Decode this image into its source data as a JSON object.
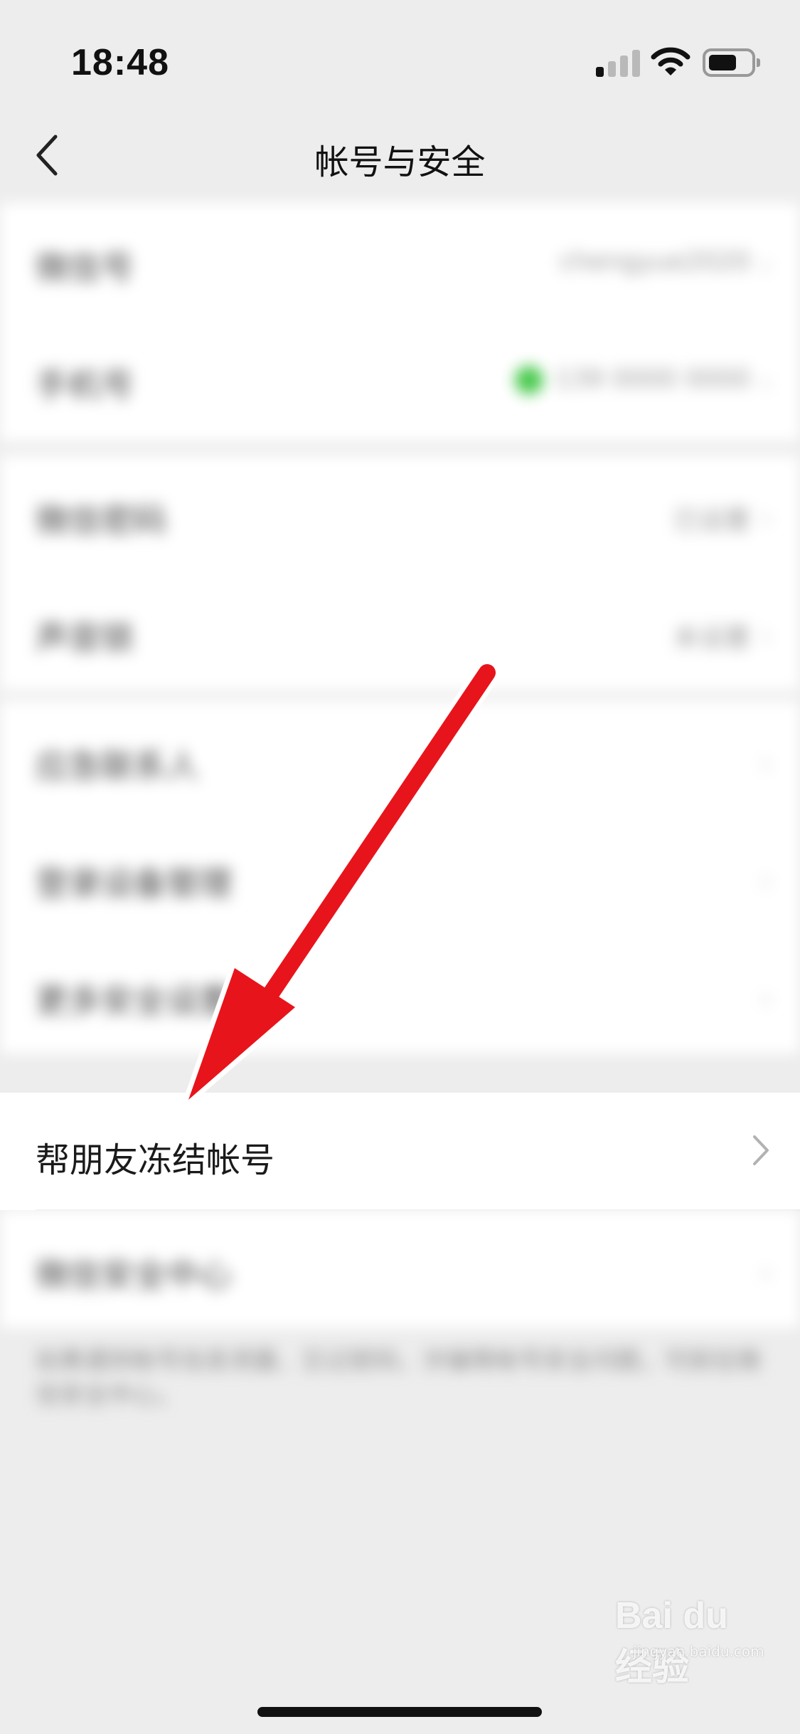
{
  "status_bar": {
    "time": "18:48"
  },
  "nav": {
    "title": "帐号与安全"
  },
  "blurred": {
    "row1_label": "微信号",
    "row1_value": "chengyue2020",
    "row2_label": "手机号",
    "row2_value": "139 0000 0000",
    "row3_label": "微信密码",
    "row3_value": "已设置",
    "row4_label": "声音锁",
    "row4_value": "未设置",
    "row5_label": "应急联系人",
    "row6_label": "登录设备管理",
    "row7_label": "更多安全设置",
    "row9_label": "微信安全中心"
  },
  "friend_freeze": {
    "label": "帮朋友冻结帐号"
  },
  "footnote": "如果遇到帐号信息泄露、忘记密码、诈骗等帐号安全问题，可前往微信安全中心。",
  "watermark": {
    "logo": "Bai du 经验",
    "sub": "jingyan.baidu.com"
  },
  "colors": {
    "arrow": "#e8141b",
    "background": "#ededed",
    "toggle_green": "#46c84a"
  },
  "icons": [
    "back-icon",
    "chevron-right-icon",
    "signal-icon",
    "wifi-icon",
    "battery-icon",
    "arrow-annotation"
  ]
}
